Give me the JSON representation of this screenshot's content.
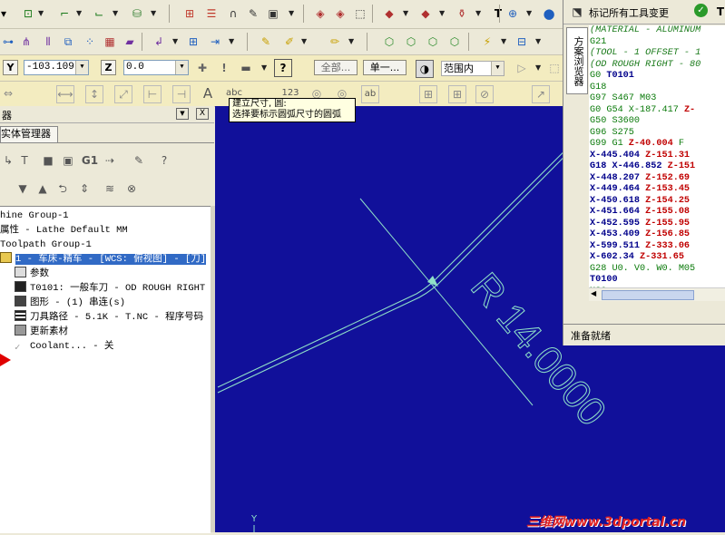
{
  "toolbar1": {
    "right_label": "标记所有工具变更"
  },
  "toolbar3": {
    "y_label": "Y",
    "y_value": "-103.109",
    "z_label": "Z",
    "z_value": "0.0",
    "all_label": "全部...",
    "single_label": "单一...",
    "range_value": "范围内"
  },
  "toolbar4": {
    "tooltip": [
      "建立尺寸, 圆:",
      "选择要标示圆弧尺寸的圆弧"
    ]
  },
  "leftpanel": {
    "title": "器",
    "tab_label": "实体管理器",
    "g1_label": "G1",
    "tree": [
      {
        "text": "hine Group-1"
      },
      {
        "text": "属性 - Lathe Default MM"
      },
      {
        "text": "Toolpath Group-1"
      },
      {
        "text": "1 - 车床-精车 - [WCS: 俯视图] - [刀]",
        "selected": true
      },
      {
        "text": "参数"
      },
      {
        "text": "T0101: 一般车刀 - OD ROUGH RIGHT"
      },
      {
        "text": "图形 - (1) 串连(s)"
      },
      {
        "text": "刀具路径 - 5.1K - T.NC - 程序号码"
      },
      {
        "text": "更新素材"
      },
      {
        "text": "Coolant... - 关"
      }
    ]
  },
  "viewport": {
    "dimension_text": "R 14.0000",
    "axis_label": "Y"
  },
  "rightpanel": {
    "side_tab": "方案浏览器",
    "status": "准备就绪",
    "code_lines": [
      {
        "parts": [
          {
            "t": "(MATERIAL - ALUMINUM",
            "c": "cm"
          }
        ]
      },
      {
        "parts": [
          {
            "t": "G21",
            "c": "gn"
          }
        ]
      },
      {
        "parts": [
          {
            "t": "(TOOL - 1 OFFSET - 1",
            "c": "cm"
          }
        ]
      },
      {
        "parts": [
          {
            "t": "(OD ROUGH RIGHT - 80",
            "c": "cm"
          }
        ]
      },
      {
        "parts": [
          {
            "t": "G0 ",
            "c": "gn"
          },
          {
            "t": "T0101",
            "c": "bl"
          }
        ]
      },
      {
        "parts": [
          {
            "t": "G18",
            "c": "gn"
          }
        ]
      },
      {
        "parts": [
          {
            "t": "G97 S467 M03",
            "c": "gn"
          }
        ]
      },
      {
        "parts": [
          {
            "t": "G0 G54 X-187.417 ",
            "c": "gn"
          },
          {
            "t": "Z-",
            "c": "rd"
          }
        ]
      },
      {
        "parts": [
          {
            "t": "G50 S3600",
            "c": "gn"
          }
        ]
      },
      {
        "parts": [
          {
            "t": "G96 S275",
            "c": "gn"
          }
        ]
      },
      {
        "parts": [
          {
            "t": "G99 G1 ",
            "c": "gn"
          },
          {
            "t": "Z-40.004",
            "c": "rd"
          },
          {
            "t": " F",
            "c": "gn"
          }
        ]
      },
      {
        "parts": [
          {
            "t": "X-445.404 ",
            "c": "bl"
          },
          {
            "t": "Z-151.31",
            "c": "rd"
          }
        ]
      },
      {
        "parts": [
          {
            "t": "G18 X-446.852 ",
            "c": "bl"
          },
          {
            "t": "Z-151",
            "c": "rd"
          }
        ]
      },
      {
        "parts": [
          {
            "t": "X-448.207 ",
            "c": "bl"
          },
          {
            "t": "Z-152.69",
            "c": "rd"
          }
        ]
      },
      {
        "parts": [
          {
            "t": "X-449.464 ",
            "c": "bl"
          },
          {
            "t": "Z-153.45",
            "c": "rd"
          }
        ]
      },
      {
        "parts": [
          {
            "t": "X-450.618 ",
            "c": "bl"
          },
          {
            "t": "Z-154.25",
            "c": "rd"
          }
        ]
      },
      {
        "parts": [
          {
            "t": "X-451.664 ",
            "c": "bl"
          },
          {
            "t": "Z-155.08",
            "c": "rd"
          }
        ]
      },
      {
        "parts": [
          {
            "t": "X-452.595 ",
            "c": "bl"
          },
          {
            "t": "Z-155.95",
            "c": "rd"
          }
        ]
      },
      {
        "parts": [
          {
            "t": "X-453.409 ",
            "c": "bl"
          },
          {
            "t": "Z-156.85",
            "c": "rd"
          }
        ]
      },
      {
        "parts": [
          {
            "t": "X-599.511 ",
            "c": "bl"
          },
          {
            "t": "Z-333.06",
            "c": "rd"
          }
        ]
      },
      {
        "parts": [
          {
            "t": "X-602.34 ",
            "c": "bl"
          },
          {
            "t": "Z-331.65",
            "c": "rd"
          }
        ]
      },
      {
        "parts": [
          {
            "t": "G28 U0. V0. W0. M05",
            "c": "gn"
          }
        ]
      },
      {
        "parts": [
          {
            "t": "T0100",
            "c": "bl"
          }
        ]
      },
      {
        "parts": [
          {
            "t": "M30",
            "c": "gn"
          }
        ]
      }
    ]
  },
  "watermark": "三维网www.3dportal.cn",
  "colors": {
    "viewport_bg": "#11109a",
    "geometry": "#8fe0c8",
    "selection": "#316ac5",
    "watermark": "#e02020"
  }
}
